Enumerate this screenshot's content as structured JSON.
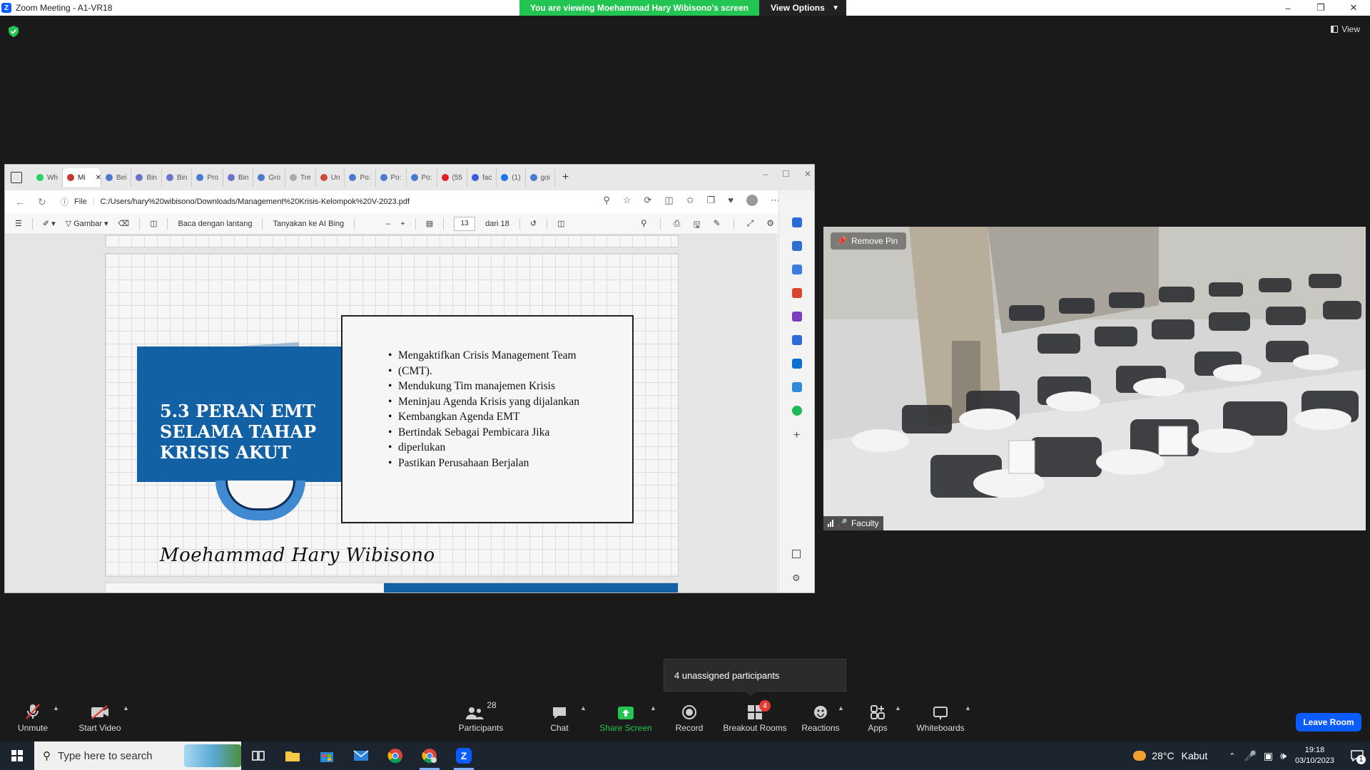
{
  "window": {
    "title": "Zoom Meeting - A1-VR18",
    "banner": "You are viewing Moehammad Hary Wibisono's screen",
    "view_options": "View Options",
    "view_label": "View"
  },
  "browser": {
    "tabs": [
      {
        "label": "Wh",
        "color": "#25d366"
      },
      {
        "label": "Mi",
        "color": "#c0392b",
        "active": true
      },
      {
        "label": "Bei",
        "color": "#4a7bd0"
      },
      {
        "label": "Bin",
        "color": "#6a74c9"
      },
      {
        "label": "Bin",
        "color": "#6a74c9"
      },
      {
        "label": "Pro",
        "color": "#4a7bd0"
      },
      {
        "label": "Bin",
        "color": "#6a74c9"
      },
      {
        "label": "Gro",
        "color": "#4a7bd0"
      },
      {
        "label": "Tre",
        "color": "#aaaaaa"
      },
      {
        "label": "Un",
        "color": "#d0473d"
      },
      {
        "label": "Po:",
        "color": "#4a7bd0"
      },
      {
        "label": "Po:",
        "color": "#4a7bd0"
      },
      {
        "label": "Po:",
        "color": "#4a7bd0"
      },
      {
        "label": "(55",
        "color": "#e02020"
      },
      {
        "label": "fac",
        "color": "#3b5bdb"
      },
      {
        "label": "(1)",
        "color": "#1877f2"
      },
      {
        "label": "goi",
        "color": "#4a7bd0"
      }
    ],
    "address_prefix": "File",
    "url": "C:/Users/hary%20wibisono/Downloads/Management%20Krisis-Kelompok%20V-2023.pdf",
    "pdf_toolbar": {
      "draw_label": "Gambar",
      "read_aloud": "Baca dengan lantang",
      "ask_bing": "Tanyakan ke AI Bing",
      "page_current": "13",
      "page_total": "dari 18"
    }
  },
  "slide": {
    "title_lines": [
      "5.3 PERAN EMT",
      "SELAMA TAHAP",
      "KRISIS AKUT"
    ],
    "bullets": [
      "Mengaktifkan Crisis Management Team",
      "(CMT).",
      "Mendukung Tim manajemen Krisis",
      "Meninjau Agenda Krisis yang dijalankan",
      "Kembangkan Agenda EMT",
      "Bertindak Sebagai Pembicara Jika",
      "diperlukan",
      "Pastikan Perusahaan Berjalan"
    ],
    "author": "Moehammad Hary Wibisono"
  },
  "video": {
    "remove_pin": "Remove Pin",
    "participant_name": "Faculty"
  },
  "tooltip": "4 unassigned participants",
  "toolbar": {
    "unmute": "Unmute",
    "start_video": "Start Video",
    "participants": "Participants",
    "participants_count": "28",
    "chat": "Chat",
    "share_screen": "Share Screen",
    "record": "Record",
    "breakout_rooms": "Breakout Rooms",
    "breakout_badge": "4",
    "reactions": "Reactions",
    "apps": "Apps",
    "whiteboards": "Whiteboards",
    "leave": "Leave Room"
  },
  "taskbar": {
    "search_placeholder": "Type here to search",
    "weather_temp": "28°C",
    "weather_desc": "Kabut",
    "time": "19:18",
    "date": "03/10/2023",
    "notif_count": "1"
  },
  "colors": {
    "zoom_blue": "#0b5cff",
    "share_green": "#23c552",
    "slide_blue": "#1261a4"
  }
}
